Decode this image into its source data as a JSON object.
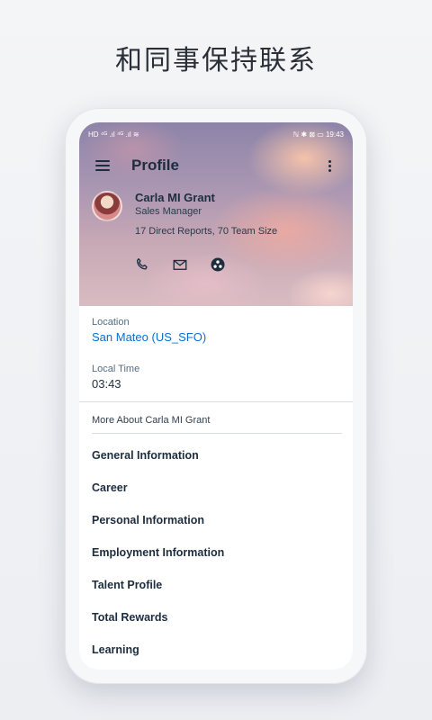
{
  "promo": {
    "title": "和同事保持联系"
  },
  "status_bar": {
    "left": "HD ⁴ᴳ .ıl ⁴ᴳ .ıl ≋",
    "right": "ℕ ✱ ⊠ ▭ 19:43"
  },
  "app_bar": {
    "title": "Profile",
    "menu_icon": "hamburger-menu-icon",
    "overflow_icon": "more-vertical-icon"
  },
  "profile": {
    "name": "Carla MI Grant",
    "role": "Sales Manager",
    "reports": "17 Direct Reports, 70 Team Size",
    "actions": [
      {
        "icon": "phone-icon"
      },
      {
        "icon": "mail-icon"
      },
      {
        "icon": "org-chart-icon"
      }
    ]
  },
  "details": {
    "location_label": "Location",
    "location_value": "San Mateo (US_SFO)",
    "time_label": "Local Time",
    "time_value": "03:43"
  },
  "more_about": {
    "heading": "More About Carla MI Grant",
    "items": [
      "General Information",
      "Career",
      "Personal Information",
      "Employment Information",
      "Talent Profile",
      "Total Rewards",
      "Learning"
    ]
  },
  "colors": {
    "link": "#0a6ed1",
    "text": "#1d2d3e",
    "background": "#eceef2"
  }
}
